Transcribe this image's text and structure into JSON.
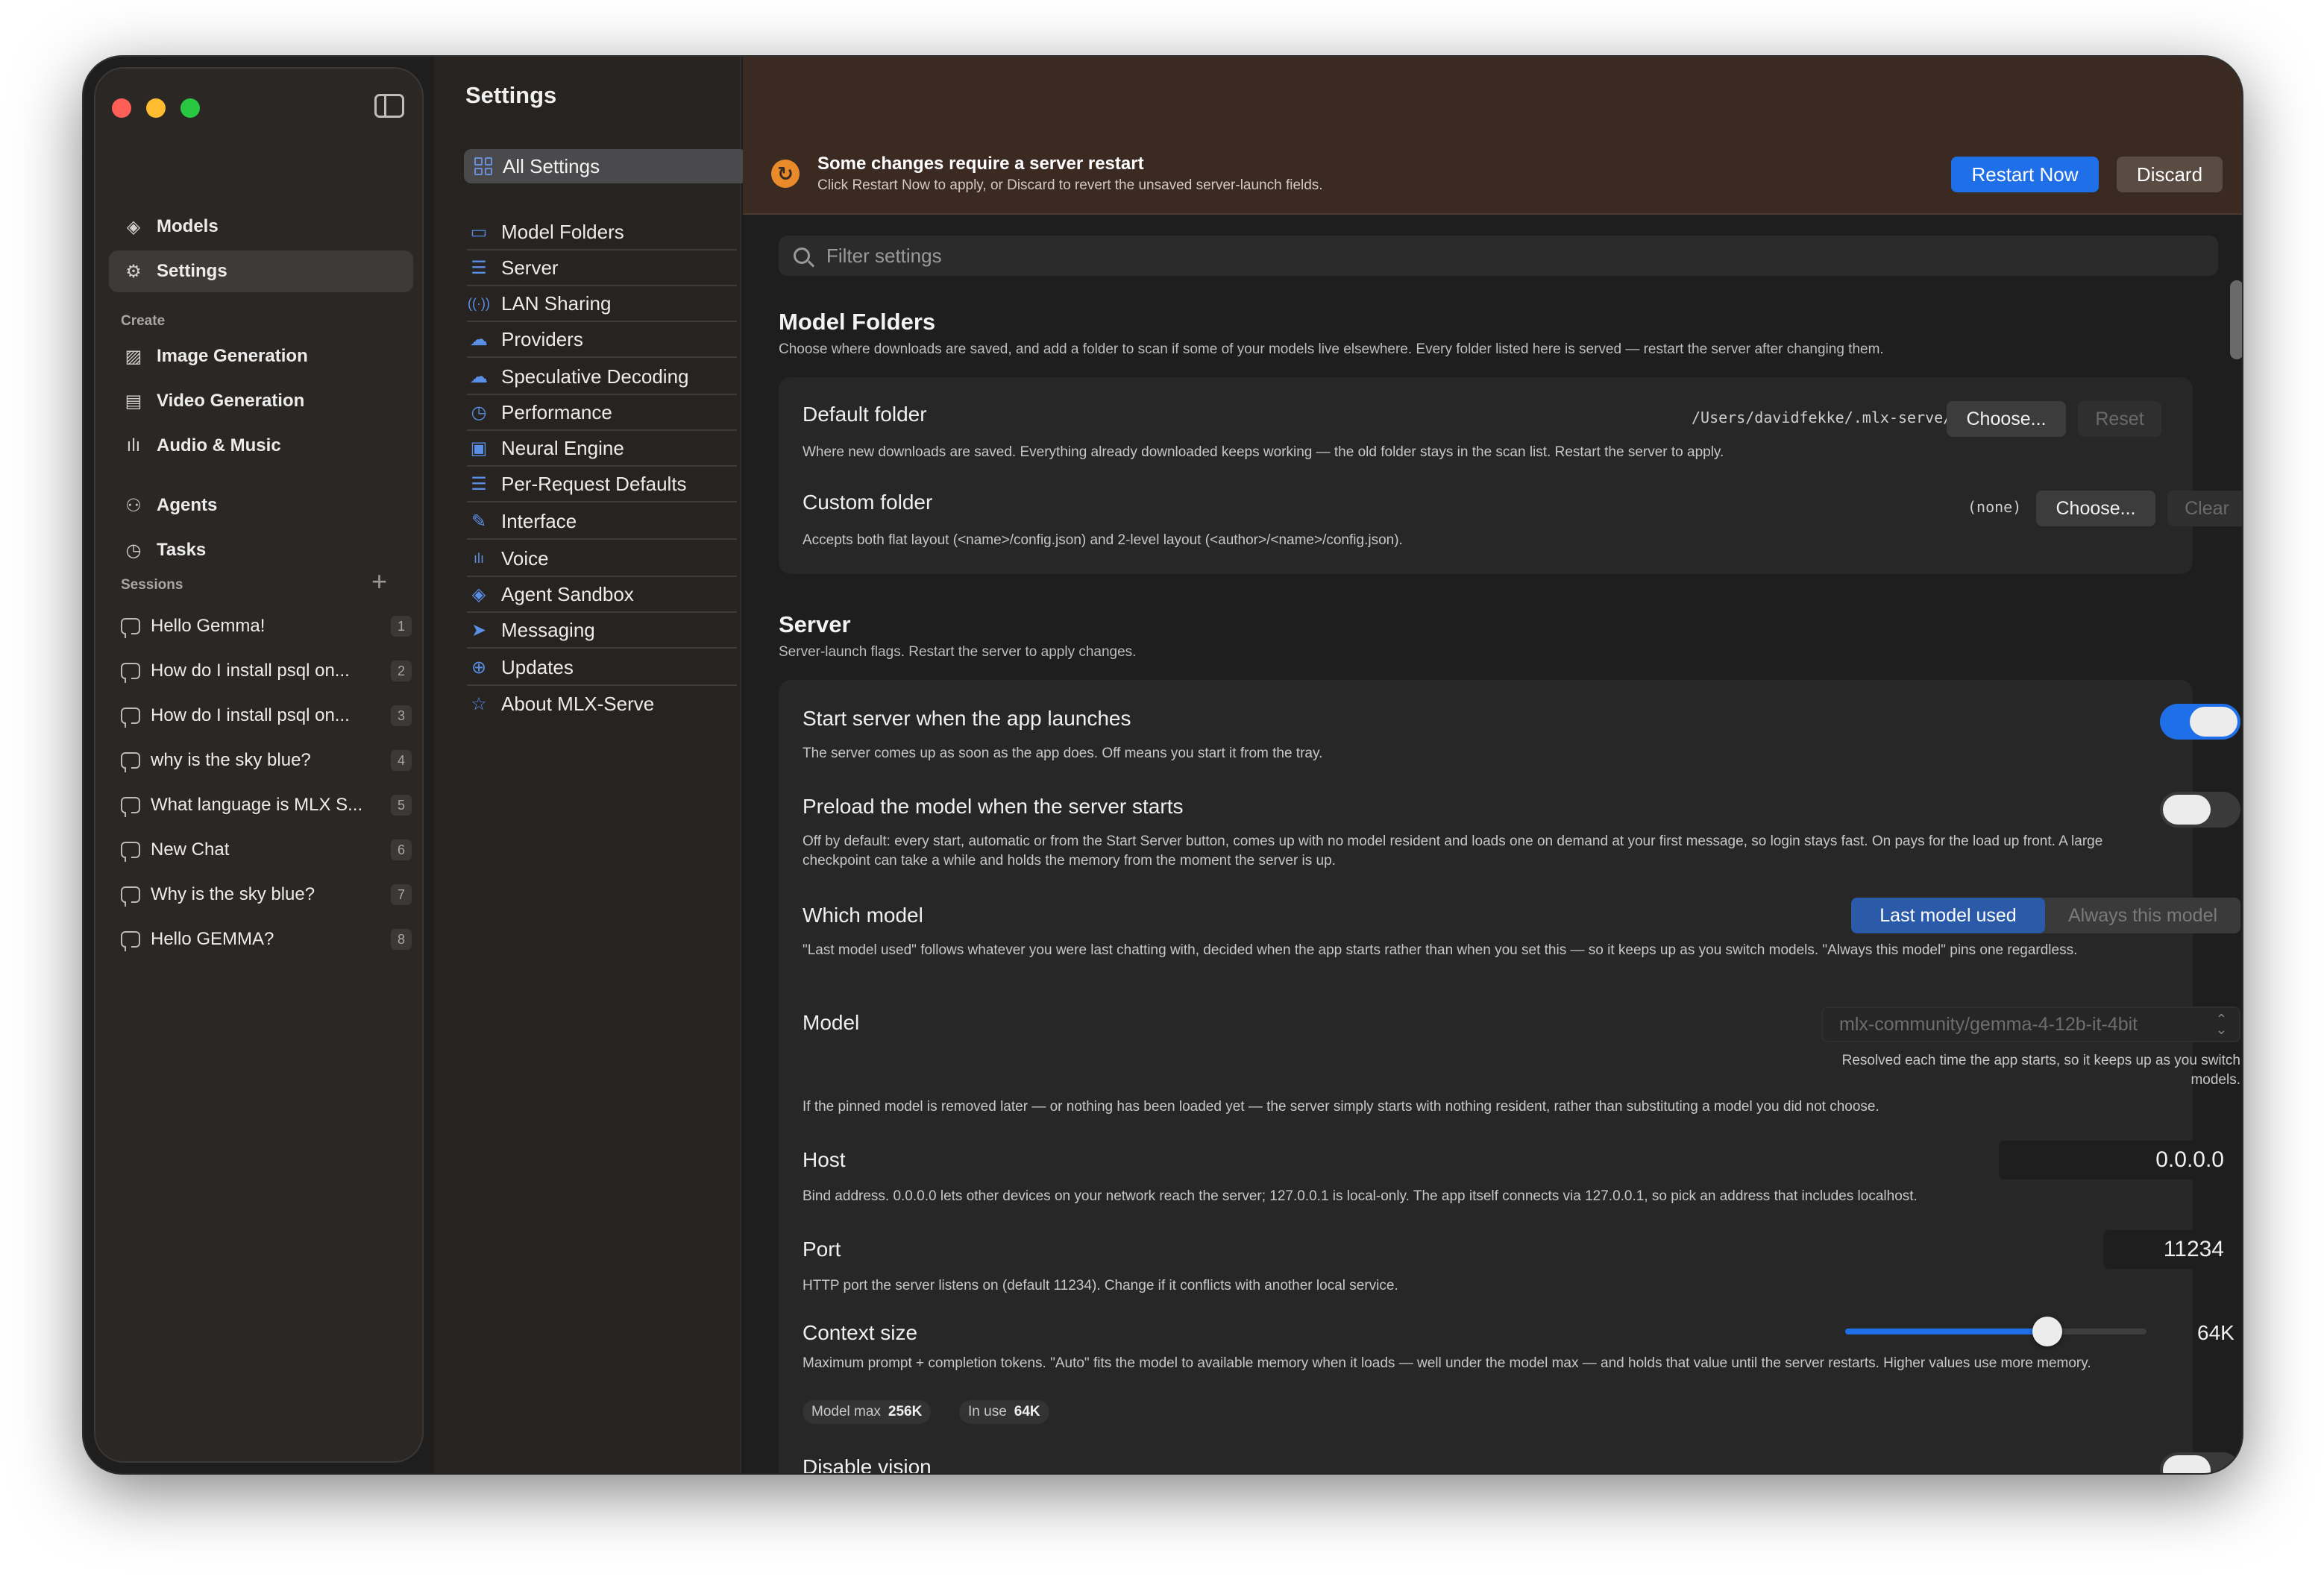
{
  "window": {
    "traffic_lights": {
      "close": "#ff5f57",
      "minimize": "#febc2e",
      "zoom": "#28c840"
    }
  },
  "sidebar": {
    "toggle_icon": "sidebar-toggle-icon",
    "top_items": [
      {
        "label": "Models",
        "icon": "stack-icon"
      },
      {
        "label": "Settings",
        "icon": "gear-icon"
      }
    ],
    "create_heading": "Create",
    "create_items": [
      {
        "label": "Image Generation",
        "icon": "photo-icon"
      },
      {
        "label": "Video Generation",
        "icon": "film-icon"
      },
      {
        "label": "Audio & Music",
        "icon": "waveform-icon"
      }
    ],
    "other_items": [
      {
        "label": "Agents",
        "icon": "people-icon"
      },
      {
        "label": "Tasks",
        "icon": "clock-icon"
      }
    ],
    "sessions_heading": "Sessions",
    "sessions": [
      {
        "title": "Hello Gemma!",
        "num": "1"
      },
      {
        "title": "How do I install psql on...",
        "num": "2"
      },
      {
        "title": "How do I install psql on...",
        "num": "3"
      },
      {
        "title": "why is the sky blue?",
        "num": "4"
      },
      {
        "title": "What language is MLX S...",
        "num": "5"
      },
      {
        "title": "New Chat",
        "num": "6"
      },
      {
        "title": "Why is the sky blue?",
        "num": "7"
      },
      {
        "title": "Hello GEMMA?",
        "num": "8"
      }
    ]
  },
  "settings_nav": {
    "title": "Settings",
    "all": "All Settings",
    "items": [
      {
        "label": "Model Folders",
        "icon": "▭"
      },
      {
        "label": "Server",
        "icon": "☰"
      },
      {
        "label": "LAN Sharing",
        "icon": "((·))"
      },
      {
        "label": "Providers",
        "icon": "☁"
      },
      {
        "label": "Speculative Decoding",
        "icon": "☁"
      },
      {
        "label": "Performance",
        "icon": "◷"
      },
      {
        "label": "Neural Engine",
        "icon": "▣"
      },
      {
        "label": "Per-Request Defaults",
        "icon": "☰"
      },
      {
        "label": "Interface",
        "icon": "✎"
      },
      {
        "label": "Voice",
        "icon": "ılı"
      },
      {
        "label": "Agent Sandbox",
        "icon": "◈"
      },
      {
        "label": "Messaging",
        "icon": "➤"
      },
      {
        "label": "Updates",
        "icon": "⊕"
      },
      {
        "label": "About MLX-Serve",
        "icon": "☆"
      }
    ]
  },
  "banner": {
    "title": "Some changes require a server restart",
    "subtitle": "Click Restart Now to apply, or Discard to revert the unsaved server-launch fields.",
    "restart": "Restart Now",
    "discard": "Discard"
  },
  "filter": {
    "placeholder": "Filter settings"
  },
  "model_folders": {
    "title": "Model Folders",
    "subtitle": "Choose where downloads are saved, and add a folder to scan if some of your models live elsewhere. Every folder listed here is served — restart the server after changing them.",
    "default": {
      "label": "Default folder",
      "path": "/Users/davidfekke/.mlx-serve/models",
      "choose": "Choose...",
      "reset": "Reset",
      "desc": "Where new downloads are saved. Everything already downloaded keeps working — the old folder stays in the scan list. Restart the server to apply."
    },
    "custom": {
      "label": "Custom folder",
      "path": "(none)",
      "choose": "Choose...",
      "clear": "Clear",
      "desc": "Accepts both flat layout (<name>/config.json) and 2-level layout (<author>/<name>/config.json)."
    }
  },
  "server": {
    "title": "Server",
    "subtitle": "Server-launch flags. Restart the server to apply changes.",
    "start": {
      "label": "Start server when the app launches",
      "desc": "The server comes up as soon as the app does. Off means you start it from the tray.",
      "on": true
    },
    "preload": {
      "label": "Preload the model when the server starts",
      "desc": "Off by default: every start, automatic or from the Start Server button, comes up with no model resident and loads one on demand at your first message, so login stays fast. On pays for the load up front. A large checkpoint can take a while and holds the memory from the moment the server is up.",
      "on": false
    },
    "which": {
      "label": "Which model",
      "opt1": "Last model used",
      "opt2": "Always this model",
      "desc": "\"Last model used\" follows whatever you were last chatting with, decided when the app starts rather than when you set this — so it keeps up as you switch models. \"Always this model\" pins one regardless."
    },
    "model": {
      "label": "Model",
      "value": "mlx-community/gemma-4-12b-it-4bit",
      "note": "Resolved each time the app starts, so it keeps up as you switch models.",
      "desc": "If the pinned model is removed later — or nothing has been loaded yet — the server simply starts with nothing resident, rather than substituting a model you did not choose."
    },
    "host": {
      "label": "Host",
      "value": "0.0.0.0",
      "desc": "Bind address. 0.0.0.0 lets other devices on your network reach the server; 127.0.0.1 is local-only. The app itself connects via 127.0.0.1, so pick an address that includes localhost."
    },
    "port": {
      "label": "Port",
      "value": "11234",
      "desc": "HTTP port the server listens on (default 11234). Change if it conflicts with another local service."
    },
    "context": {
      "label": "Context size",
      "value": "64K",
      "fraction": 0.67,
      "desc": "Maximum prompt + completion tokens. \"Auto\" fits the model to available memory when it loads — well under the model max — and holds that value until the server restarts. Higher values use more memory.",
      "max_label": "Model max",
      "max_value": "256K",
      "inuse_label": "In use",
      "inuse_value": "64K"
    },
    "vision": {
      "label": "Disable vision",
      "on": false
    }
  },
  "colors": {
    "accent": "#1f6fe8",
    "banner_bg": "#3a2a22",
    "warning": "#e98b2a"
  }
}
